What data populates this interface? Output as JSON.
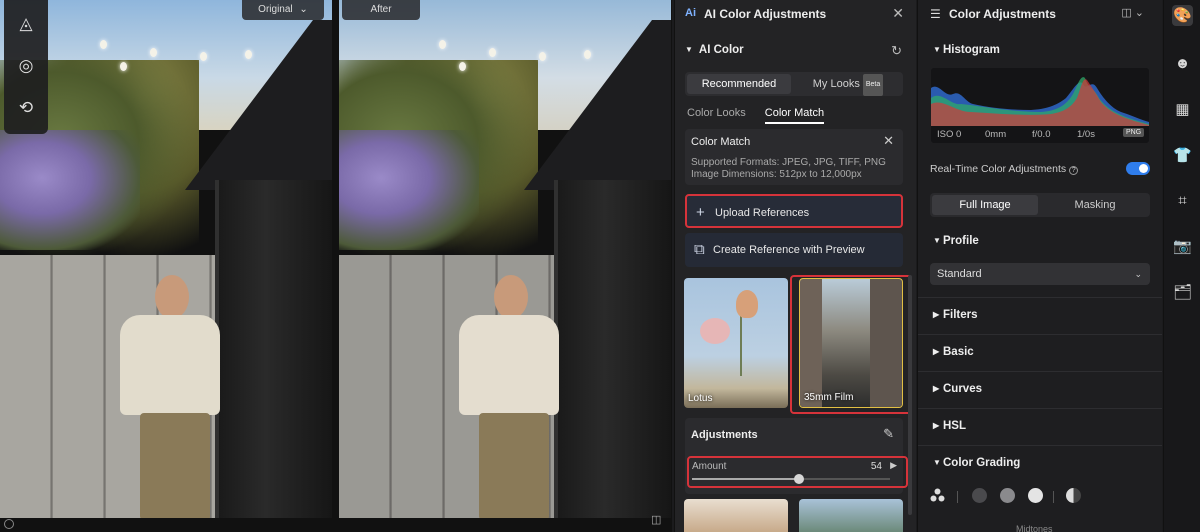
{
  "canvas": {
    "original_label": "Original",
    "original_chevron": "⌄",
    "after_label": "After",
    "tools": [
      {
        "name": "adjust-triangle-icon",
        "glyph": "◬"
      },
      {
        "name": "ai-dots-icon",
        "glyph": "◎"
      },
      {
        "name": "history-icon",
        "glyph": "⟲"
      }
    ],
    "compare_icon": "◫"
  },
  "ai_panel": {
    "logo": "Ai",
    "title": "AI Color Adjustments",
    "close_icon": "✕",
    "section_title": "AI Color",
    "reset_icon": "↻",
    "modes": {
      "recommended": "Recommended",
      "my_looks": "My Looks",
      "beta": "Beta"
    },
    "subtabs": {
      "color_looks": "Color Looks",
      "color_match": "Color Match"
    },
    "color_match": {
      "title": "Color Match",
      "formats": "Supported Formats: JPEG, JPG, TIFF, PNG",
      "dimensions": "Image Dimensions: 512px to 12,000px"
    },
    "upload_label": "Upload References",
    "upload_icon": "+",
    "create_label": "Create Reference with Preview",
    "create_icon": "⧉",
    "references": [
      {
        "caption": "Lotus"
      },
      {
        "caption": "35mm Film"
      }
    ],
    "adjustments": {
      "title": "Adjustments",
      "edit_icon": "✎",
      "amount_label": "Amount",
      "amount_value": "54",
      "amount_fraction": 0.54,
      "amount_arrow": "▶"
    }
  },
  "color_panel": {
    "header_icon": "☰",
    "title": "Color Adjustments",
    "layout_icon": "◫ ⌄",
    "histogram": {
      "title": "Histogram",
      "iso": "ISO 0",
      "focal": "0mm",
      "aperture": "f/0.0",
      "shutter": "1/0s",
      "format": "PNG"
    },
    "realtime_label": "Real-Time Color Adjustments",
    "realtime_info": "?",
    "realtime_on": true,
    "scope": {
      "full_image": "Full Image",
      "masking": "Masking"
    },
    "profile": {
      "title": "Profile",
      "value": "Standard",
      "chevron": "⌄"
    },
    "sections": [
      "Filters",
      "Basic",
      "Curves",
      "HSL"
    ],
    "color_grading": {
      "title": "Color Grading",
      "sub_label": "Midtones"
    },
    "colors": {
      "accent_red": "#d6333a",
      "toggle_blue": "#2f7dec"
    }
  },
  "rail": {
    "items": [
      {
        "name": "palette-icon",
        "glyph": "🎨"
      },
      {
        "name": "face-icon",
        "glyph": "☻"
      },
      {
        "name": "texture-icon",
        "glyph": "▦"
      },
      {
        "name": "shirt-icon",
        "glyph": "👕"
      },
      {
        "name": "crop-icon",
        "glyph": "⌗"
      },
      {
        "name": "camera-icon",
        "glyph": "📷"
      },
      {
        "name": "folder-search-icon",
        "glyph": "🗂"
      }
    ]
  }
}
